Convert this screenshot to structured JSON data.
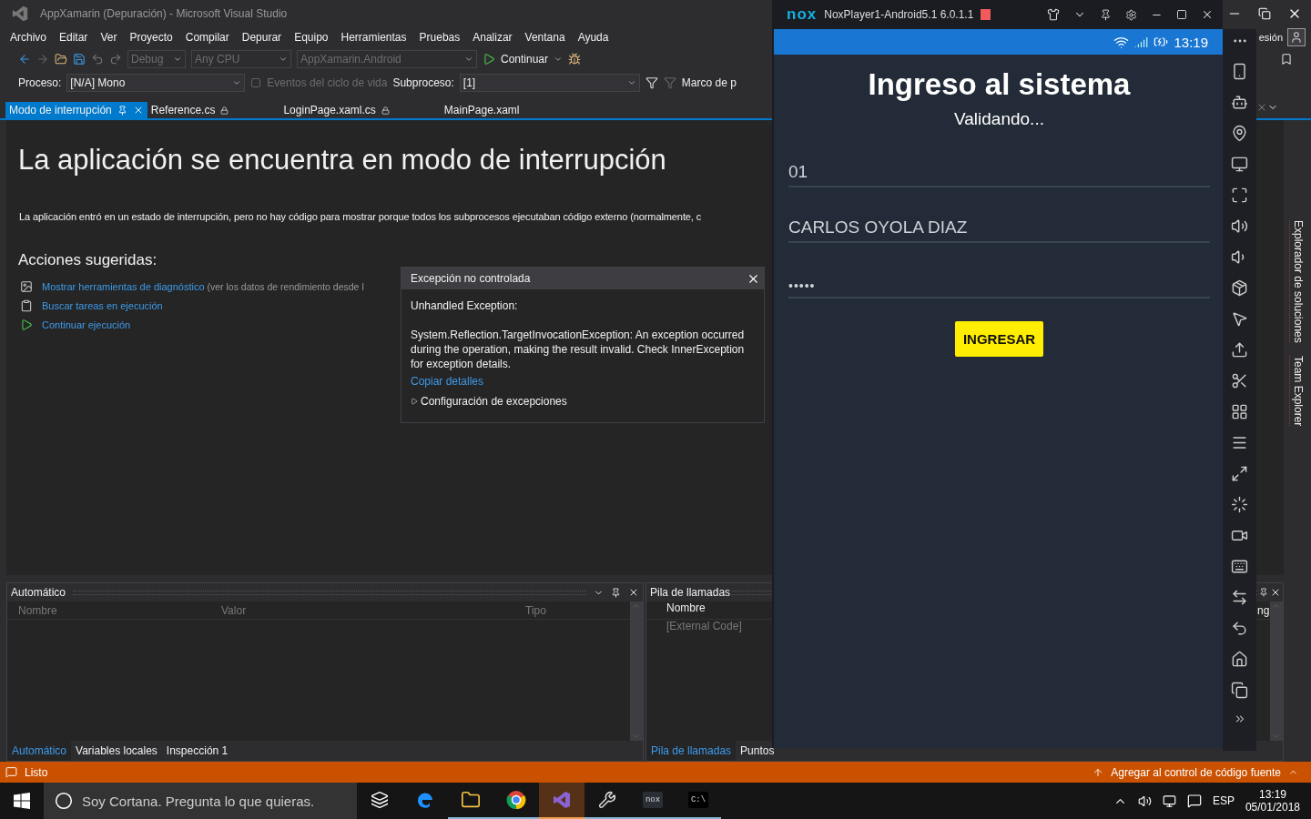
{
  "vs": {
    "title": "AppXamarin (Depuración) - Microsoft Visual Studio",
    "menu": [
      "Archivo",
      "Editar",
      "Ver",
      "Proyecto",
      "Compilar",
      "Depurar",
      "Equipo",
      "Herramientas",
      "Pruebas",
      "Analizar",
      "Ventana",
      "Ayuda"
    ],
    "signin": "esión",
    "toolbar": {
      "configuration": "Debug",
      "platform": "Any CPU",
      "startup": "AppXamarin.Android",
      "continue": "Continuar"
    },
    "debug_location": {
      "process_label": "Proceso:",
      "process": "[N/A] Mono",
      "lifecycle": "Eventos del ciclo de vida",
      "thread_label": "Subproceso:",
      "thread": "[1]",
      "frame_label": "Marco de p"
    },
    "tabs": [
      {
        "label": "Modo de interrupción",
        "selected": true,
        "pinned": true,
        "locked": false
      },
      {
        "label": "Reference.cs",
        "selected": false,
        "pinned": false,
        "locked": true
      },
      {
        "label": "LoginPage.xaml.cs",
        "selected": false,
        "pinned": false,
        "locked": true
      },
      {
        "label": "MainPage.xaml",
        "selected": false,
        "pinned": false,
        "locked": false
      }
    ],
    "break_mode": {
      "heading": "La aplicación se encuentra en modo de interrupción",
      "description": "La aplicación entró en un estado de interrupción, pero no hay código para mostrar porque todos los subprocesos ejecutaban código externo (normalmente, c",
      "actions_title": "Acciones sugeridas:",
      "actions": [
        {
          "kind": "diagnostics",
          "link": "Mostrar herramientas de diagnóstico",
          "note": "(ver los datos de rendimiento desde l"
        },
        {
          "kind": "tasks",
          "link": "Buscar tareas en ejecución"
        },
        {
          "kind": "continue",
          "link": "Continuar ejecución"
        }
      ]
    },
    "exception_popup": {
      "title": "Excepción no controlada",
      "heading": "Unhandled Exception:",
      "message": "System.Reflection.TargetInvocationException: An exception occurred during the operation, making the result invalid.  Check InnerException for exception details.",
      "link": "Copiar detalles",
      "settings": "Configuración de excepciones"
    },
    "autos_panel": {
      "title": "Automático",
      "columns": [
        "Nombre",
        "Valor",
        "Tipo"
      ],
      "tabs": [
        {
          "label": "Automático",
          "selected": true
        },
        {
          "label": "Variables locales",
          "selected": false
        },
        {
          "label": "Inspección 1",
          "selected": false
        }
      ]
    },
    "call_stack": {
      "title": "Pila de llamadas",
      "columns": [
        "Nombre",
        "ng"
      ],
      "rows": [
        "[External Code]"
      ],
      "tabs": [
        {
          "label": "Pila de llamadas",
          "selected": true
        },
        {
          "label": "Puntos",
          "selected": false
        }
      ]
    },
    "side_tabs": [
      "Explorador de soluciones",
      "Team Explorer"
    ],
    "status_bar": {
      "status": "Listo",
      "source_control": "Agregar al control de código fuente"
    }
  },
  "nox": {
    "logo": "nox",
    "title": "NoxPlayer1-Android5.1 6.0.1.1",
    "clock": "13:19",
    "app": {
      "title": "Ingreso al sistema",
      "status": "Validando...",
      "fields": [
        {
          "kind": "text",
          "value": "01"
        },
        {
          "kind": "text",
          "value": "CARLOS OYOLA DIAZ"
        },
        {
          "kind": "password",
          "value": "•••••"
        }
      ],
      "button": "INGRESAR"
    }
  },
  "taskbar": {
    "search_placeholder": "Soy Cortana. Pregunta lo que quieras.",
    "apps": [
      {
        "kind": "taskview",
        "running": false,
        "selected": false
      },
      {
        "kind": "edge",
        "running": false,
        "selected": false
      },
      {
        "kind": "explorer",
        "running": true,
        "selected": false
      },
      {
        "kind": "chrome",
        "running": true,
        "selected": false
      },
      {
        "kind": "vs",
        "running": true,
        "selected": true
      },
      {
        "kind": "tools",
        "running": true,
        "selected": false
      },
      {
        "kind": "nox",
        "running": true,
        "selected": false,
        "text": "nox"
      },
      {
        "kind": "cmd",
        "running": true,
        "selected": false,
        "text": "C:\\"
      }
    ],
    "language": "ESP",
    "time": "13:19",
    "date": "05/01/2018"
  }
}
